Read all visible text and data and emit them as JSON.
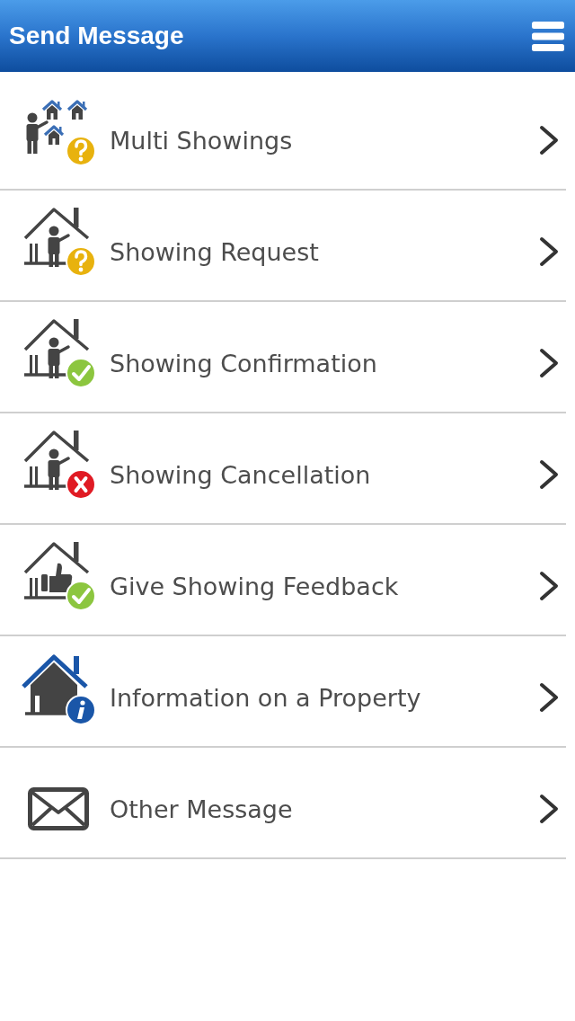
{
  "header": {
    "title": "Send Message"
  },
  "items": [
    {
      "kind": "multi",
      "label": "Multi Showings"
    },
    {
      "kind": "request",
      "label": "Showing Request"
    },
    {
      "kind": "confirmation",
      "label": "Showing Confirmation"
    },
    {
      "kind": "cancellation",
      "label": "Showing Cancellation"
    },
    {
      "kind": "feedback",
      "label": "Give Showing Feedback"
    },
    {
      "kind": "info",
      "label": "Information on a Property"
    },
    {
      "kind": "mail",
      "label": "Other Message"
    }
  ]
}
